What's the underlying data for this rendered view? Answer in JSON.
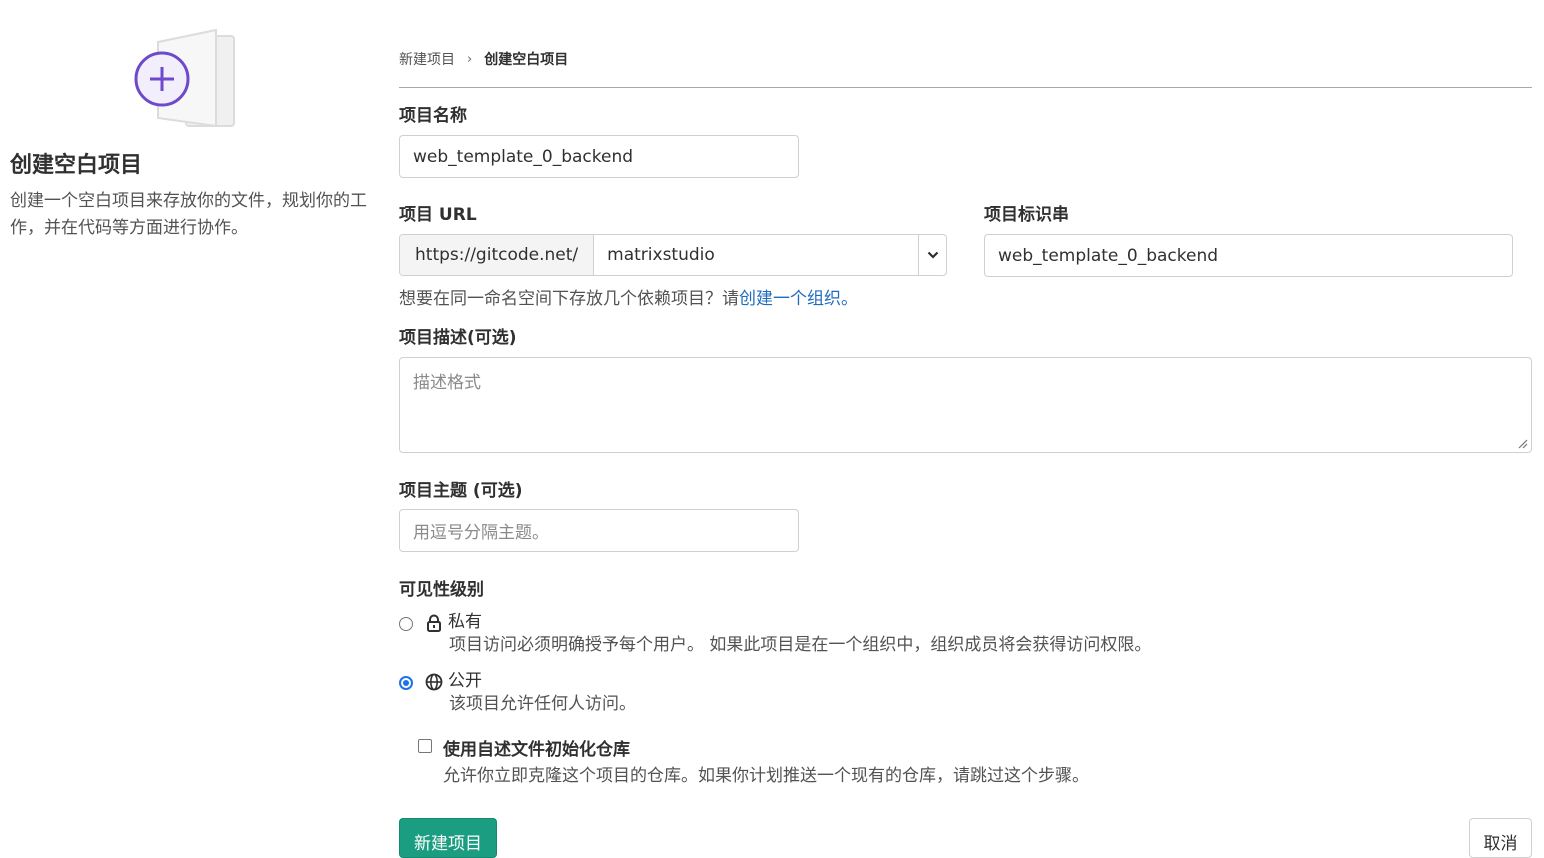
{
  "sidebar": {
    "title": "创建空白项目",
    "description": "创建一个空白项目来存放你的文件，规划你的工作，并在代码等方面进行协作。"
  },
  "breadcrumb": {
    "parent": "新建项目",
    "separator": "›",
    "current": "创建空白项目"
  },
  "form": {
    "project_name": {
      "label": "项目名称",
      "value": "web_template_0_backend"
    },
    "project_url": {
      "label": "项目 URL",
      "prefix": "https://gitcode.net/",
      "namespace": "matrixstudio"
    },
    "project_slug": {
      "label": "项目标识串",
      "value": "web_template_0_backend"
    },
    "help": {
      "text": "想要在同一命名空间下存放几个依赖项目？请",
      "link": "创建一个组织。"
    },
    "description": {
      "label": "项目描述(可选)",
      "placeholder": "描述格式"
    },
    "topics": {
      "label": "项目主题 (可选)",
      "placeholder": "用逗号分隔主题。"
    },
    "visibility": {
      "label": "可见性级别",
      "options": [
        {
          "icon": "lock-icon",
          "label": "私有",
          "description": "项目访问必须明确授予每个用户。 如果此项目是在一个组织中，组织成员将会获得访问权限。",
          "selected": false
        },
        {
          "icon": "globe-icon",
          "label": "公开",
          "description": "该项目允许任何人访问。",
          "selected": true
        }
      ]
    },
    "readme": {
      "label": "使用自述文件初始化仓库",
      "description": "允许你立即克隆这个项目的仓库。如果你计划推送一个现有的仓库，请跳过这个步骤。",
      "checked": false
    },
    "submit_label": "新建项目",
    "cancel_label": "取消"
  },
  "colors": {
    "accent": "#1a9d80",
    "link": "#1f6bbf",
    "radio": "#1a73e8",
    "illustration": "#6e49cb"
  }
}
